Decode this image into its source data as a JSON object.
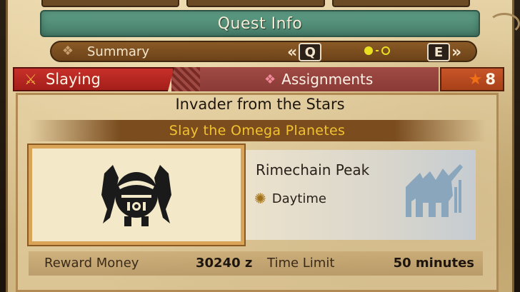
{
  "header": {
    "title": "Quest Info"
  },
  "summary_bar": {
    "icon": "book-icon",
    "label": "Summary",
    "prev_key": "Q",
    "next_key": "E",
    "prev_chevron": "«",
    "next_chevron": "»",
    "page_indicator": {
      "current": 1,
      "total": 2
    }
  },
  "tabs": {
    "slaying": {
      "label": "Slaying",
      "icon": "sword-icon"
    },
    "assignments": {
      "label": "Assignments",
      "icon": "assignments-icon"
    },
    "rank": {
      "value": "8",
      "icon": "star-icon"
    }
  },
  "quest": {
    "name": "Invader from the Stars",
    "objective": "Slay the Omega Planetes",
    "monster_icon": "omega-planetes-icon",
    "locale": "Rimechain Peak",
    "time_of_day": "Daytime",
    "time_icon": "sun-icon",
    "locale_icon": "rimechain-peak-icon"
  },
  "details": {
    "reward_label": "Reward Money",
    "reward_value": "30240 z",
    "time_limit_label": "Time Limit",
    "time_limit_value": "50 minutes"
  },
  "colors": {
    "header_green": "#4f8c76",
    "summary_brown": "#7a4c1e",
    "slaying_red": "#b82622",
    "objective_gold": "#f2c230",
    "rank_orange": "#c24a20"
  }
}
